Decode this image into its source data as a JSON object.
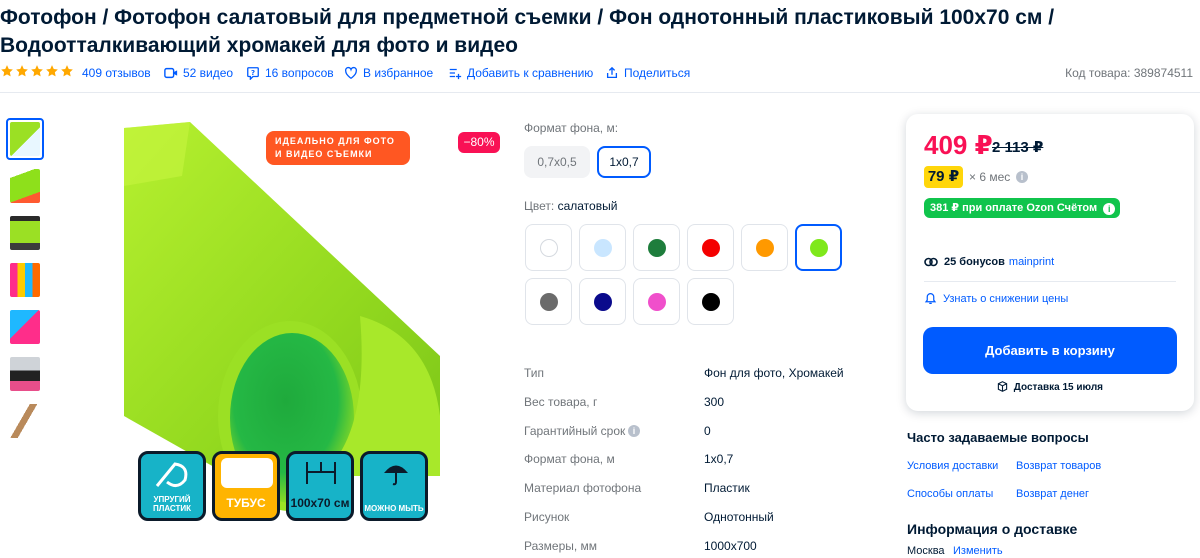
{
  "product": {
    "title": "Фотофон / Фотофон салатовый для предметной съемки / Фон однотонный пластиковый 100х70 см / Водоотталкивающий хромакей для фото и видео",
    "rating_stars": 5,
    "reviews": "409 отзывов",
    "videos": "52 видео",
    "questions": "16 вопросов",
    "favorite": "В избранное",
    "compare": "Добавить к сравнению",
    "share": "Поделиться",
    "code": "Код товара: 389874511"
  },
  "image": {
    "promo_line1": "ИДЕАЛЬНО ДЛЯ ФОТО",
    "promo_line2": "И ВИДЕО СЪЕМКИ",
    "discount": "−80%",
    "features": [
      {
        "label": "УПРУГИЙ ПЛАСТИК"
      },
      {
        "label": "ТУБУС"
      },
      {
        "label": "100х70 см"
      },
      {
        "label": "МОЖНО МЫТЬ"
      }
    ]
  },
  "options": {
    "format_label": "Формат фона, м:",
    "formats": [
      "0,7х0,5",
      "1х0,7"
    ],
    "selected_format": "1х0,7",
    "color_label": "Цвет:",
    "color_value": "салатовый",
    "colors": [
      "#ffffff",
      "#c9e6ff",
      "#1e7d3c",
      "#f40000",
      "#ff9900",
      "#7fe81b",
      "#6b6b6b",
      "#0a0a8c",
      "#f04fcb",
      "#000000"
    ],
    "selected_color_index": 5
  },
  "specs": [
    {
      "k": "Тип",
      "v": "Фон для фото, Хромакей"
    },
    {
      "k": "Вес товара, г",
      "v": "300"
    },
    {
      "k": "Гарантийный срок",
      "v": "0"
    },
    {
      "k": "Формат фона, м",
      "v": "1х0,7"
    },
    {
      "k": "Материал фотофона",
      "v": "Пластик"
    },
    {
      "k": "Рисунок",
      "v": "Однотонный"
    },
    {
      "k": "Размеры, мм",
      "v": "1000х700"
    }
  ],
  "buy": {
    "price": "409 ₽",
    "old_price": "2 113 ₽",
    "installment": "79 ₽",
    "installment_term": "× 6 мес",
    "ozon_offer": "381 ₽ при оплате Ozon Счётом",
    "bonus": "25 бонусов",
    "bonus_brand": "mainprint",
    "notify": "Узнать о снижении цены",
    "add_to_cart": "Добавить в корзину",
    "delivery": "Доставка 15 июля"
  },
  "faq": {
    "title": "Часто задаваемые вопросы",
    "links": [
      "Условия доставки",
      "Возврат товаров",
      "Способы оплаты",
      "Возврат денег"
    ]
  },
  "delivery_info": {
    "title": "Информация о доставке",
    "city": "Москва",
    "change": "Изменить"
  },
  "colors": {
    "accent": "#005bff",
    "price": "#f91155",
    "ozon_green": "#10c44c",
    "installment": "#ffd60a"
  }
}
